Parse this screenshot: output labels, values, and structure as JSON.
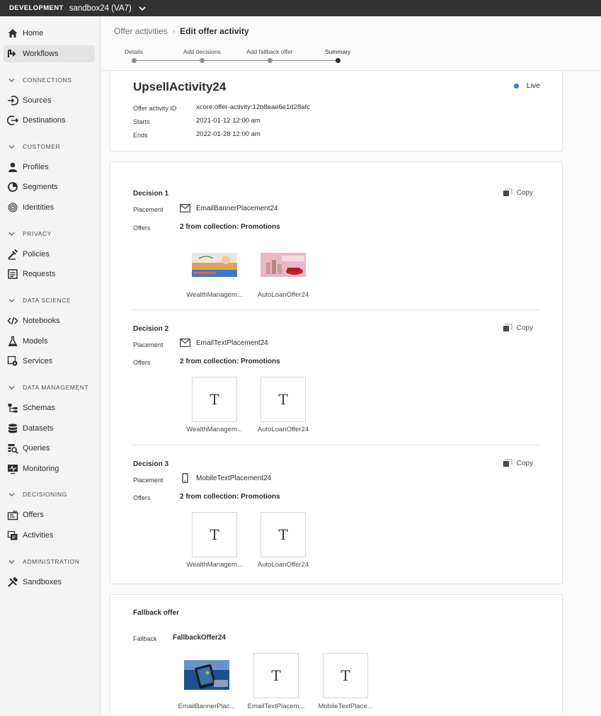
{
  "topbar": {
    "environment": "DEVELOPMENT",
    "sandbox": "sandbox24 (VA7)"
  },
  "sidebar": {
    "items": [
      {
        "label": "Home",
        "icon": "home-icon"
      },
      {
        "label": "Workflows",
        "icon": "workflows-icon",
        "active": true
      },
      {
        "label": "Sources",
        "icon": "sources-icon"
      },
      {
        "label": "Destinations",
        "icon": "destinations-icon"
      },
      {
        "label": "Profiles",
        "icon": "profiles-icon"
      },
      {
        "label": "Segments",
        "icon": "segments-icon"
      },
      {
        "label": "Identities",
        "icon": "identities-icon"
      },
      {
        "label": "Policies",
        "icon": "policies-icon"
      },
      {
        "label": "Requests",
        "icon": "requests-icon"
      },
      {
        "label": "Notebooks",
        "icon": "notebooks-icon"
      },
      {
        "label": "Models",
        "icon": "models-icon"
      },
      {
        "label": "Services",
        "icon": "services-icon"
      },
      {
        "label": "Schemas",
        "icon": "schemas-icon"
      },
      {
        "label": "Datasets",
        "icon": "datasets-icon"
      },
      {
        "label": "Queries",
        "icon": "queries-icon"
      },
      {
        "label": "Monitoring",
        "icon": "monitoring-icon"
      },
      {
        "label": "Offers",
        "icon": "offers-icon"
      },
      {
        "label": "Activities",
        "icon": "activities-icon"
      },
      {
        "label": "Sandboxes",
        "icon": "sandboxes-icon"
      }
    ],
    "sections": [
      "CONNECTIONS",
      "CUSTOMER",
      "PRIVACY",
      "DATA SCIENCE",
      "DATA MANAGEMENT",
      "DECISIONING",
      "ADMINISTRATION"
    ]
  },
  "breadcrumb": {
    "parent": "Offer activities",
    "current": "Edit offer activity"
  },
  "steps": [
    "Details",
    "Add decisions",
    "Add fallback offer",
    "Summary"
  ],
  "activity": {
    "name": "UpsellActivity24",
    "status": "Live",
    "status_color": "#2680eb",
    "id_label": "Offer activity ID",
    "id": "xcore:offer-activity:12b8eae6e1d28afc",
    "starts_label": "Starts",
    "starts": "2021-01-12 12:00 am",
    "ends_label": "Ends",
    "ends": "2022-01-28 12:00 am"
  },
  "labels": {
    "placement": "Placement",
    "offers": "Offers",
    "copy": "Copy"
  },
  "decisions": [
    {
      "title": "Decision 1",
      "placement": "EmailBannerPlacement24",
      "placement_icon": "email-icon",
      "offers": "2 from collection: Promotions",
      "items": [
        {
          "label": "WealthManagem...",
          "kind": "image"
        },
        {
          "label": "AutoLoanOffer24",
          "kind": "image"
        }
      ]
    },
    {
      "title": "Decision 2",
      "placement": "EmailTextPlacement24",
      "placement_icon": "email-icon",
      "offers": "2 from collection: Promotions",
      "items": [
        {
          "label": "WealthManagem...",
          "kind": "text",
          "glyph": "T"
        },
        {
          "label": "AutoLoanOffer24",
          "kind": "text",
          "glyph": "T"
        }
      ]
    },
    {
      "title": "Decision 3",
      "placement": "MobileTextPlacement24",
      "placement_icon": "mobile-icon",
      "offers": "2 from collection: Promotions",
      "items": [
        {
          "label": "WealthManagem...",
          "kind": "text",
          "glyph": "T"
        },
        {
          "label": "AutoLoanOffer24",
          "kind": "text",
          "glyph": "T"
        }
      ]
    }
  ],
  "fallback": {
    "title": "Fallback offer",
    "label": "Fallback",
    "name": "FallbackOffer24",
    "items": [
      {
        "label": "EmailBannerPlac...",
        "kind": "image"
      },
      {
        "label": "EmailTextPlacem...",
        "kind": "text",
        "glyph": "T"
      },
      {
        "label": "MobileTextPlace...",
        "kind": "text",
        "glyph": "T"
      }
    ]
  }
}
